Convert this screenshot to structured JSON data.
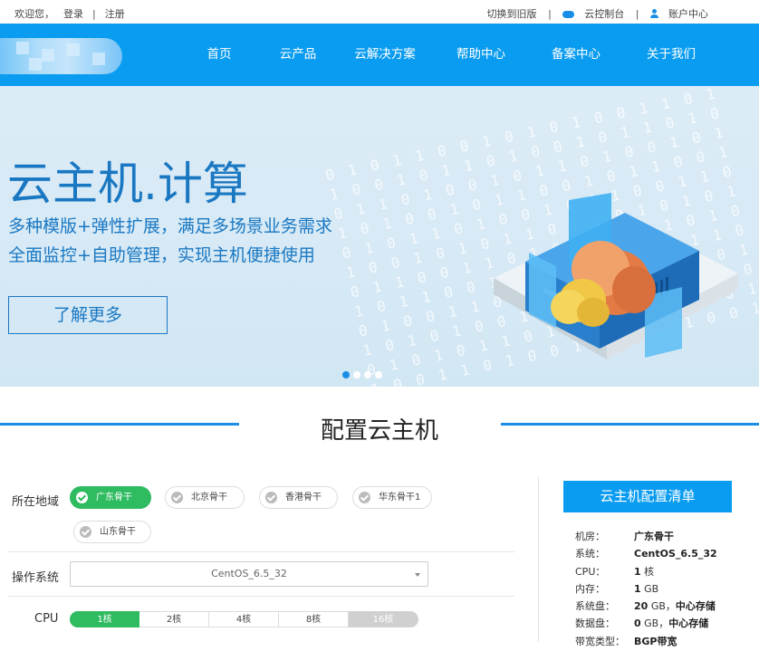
{
  "topbar": {
    "welcome": "欢迎您，",
    "login": "登录",
    "sep1": "|",
    "register": "注册",
    "old_version": "切换到旧版",
    "sep2": "|",
    "console": "云控制台",
    "sep3": "|",
    "account": "账户中心"
  },
  "nav": {
    "items": [
      "首页",
      "云产品",
      "云解决方案",
      "帮助中心",
      "备案中心",
      "关于我们"
    ]
  },
  "banner": {
    "title": "云主机.计算",
    "subtitle1": "多种模版+弹性扩展，满足多场景业务需求",
    "subtitle2": "全面监控+自助管理，实现主机便捷使用",
    "button": "了解更多",
    "slides_count": 4,
    "active_slide": 1
  },
  "section": {
    "title": "配置云主机"
  },
  "config": {
    "region_label": "所在地域",
    "regions": [
      {
        "label": "广东骨干",
        "selected": true
      },
      {
        "label": "北京骨干",
        "selected": false
      },
      {
        "label": "香港骨干",
        "selected": false
      },
      {
        "label": "华东骨干1",
        "selected": false
      },
      {
        "label": "山东骨干",
        "selected": false
      }
    ],
    "os_label": "操作系统",
    "os_value": "CentOS_6.5_32",
    "cpu_label": "CPU",
    "cpu_options": [
      {
        "label": "1核",
        "selected": true
      },
      {
        "label": "2核",
        "selected": false
      },
      {
        "label": "4核",
        "selected": false
      },
      {
        "label": "8核",
        "selected": false
      },
      {
        "label": "16核",
        "selected": false,
        "disabled": true
      }
    ]
  },
  "summary": {
    "button": "云主机配置清单",
    "rows": [
      {
        "key": "机房：",
        "value": "广东骨干",
        "unit": ""
      },
      {
        "key": "系统：",
        "value": "CentOS_6.5_32",
        "unit": ""
      },
      {
        "key": "CPU：",
        "value": "1",
        "unit": "核"
      },
      {
        "key": "内存：",
        "value": "1",
        "unit": "GB"
      },
      {
        "key": "系统盘：",
        "value": "20",
        "unit": "GB，",
        "extra": "中心存储"
      },
      {
        "key": "数据盘：",
        "value": "0",
        "unit": "GB，",
        "extra": "中心存储"
      },
      {
        "key": "带宽类型：",
        "value": "BGP带宽",
        "unit": ""
      }
    ]
  },
  "colors": {
    "brand_blue": "#0a9cf0",
    "selected_green": "#2fbb60",
    "banner_text": "#1a78c2"
  }
}
